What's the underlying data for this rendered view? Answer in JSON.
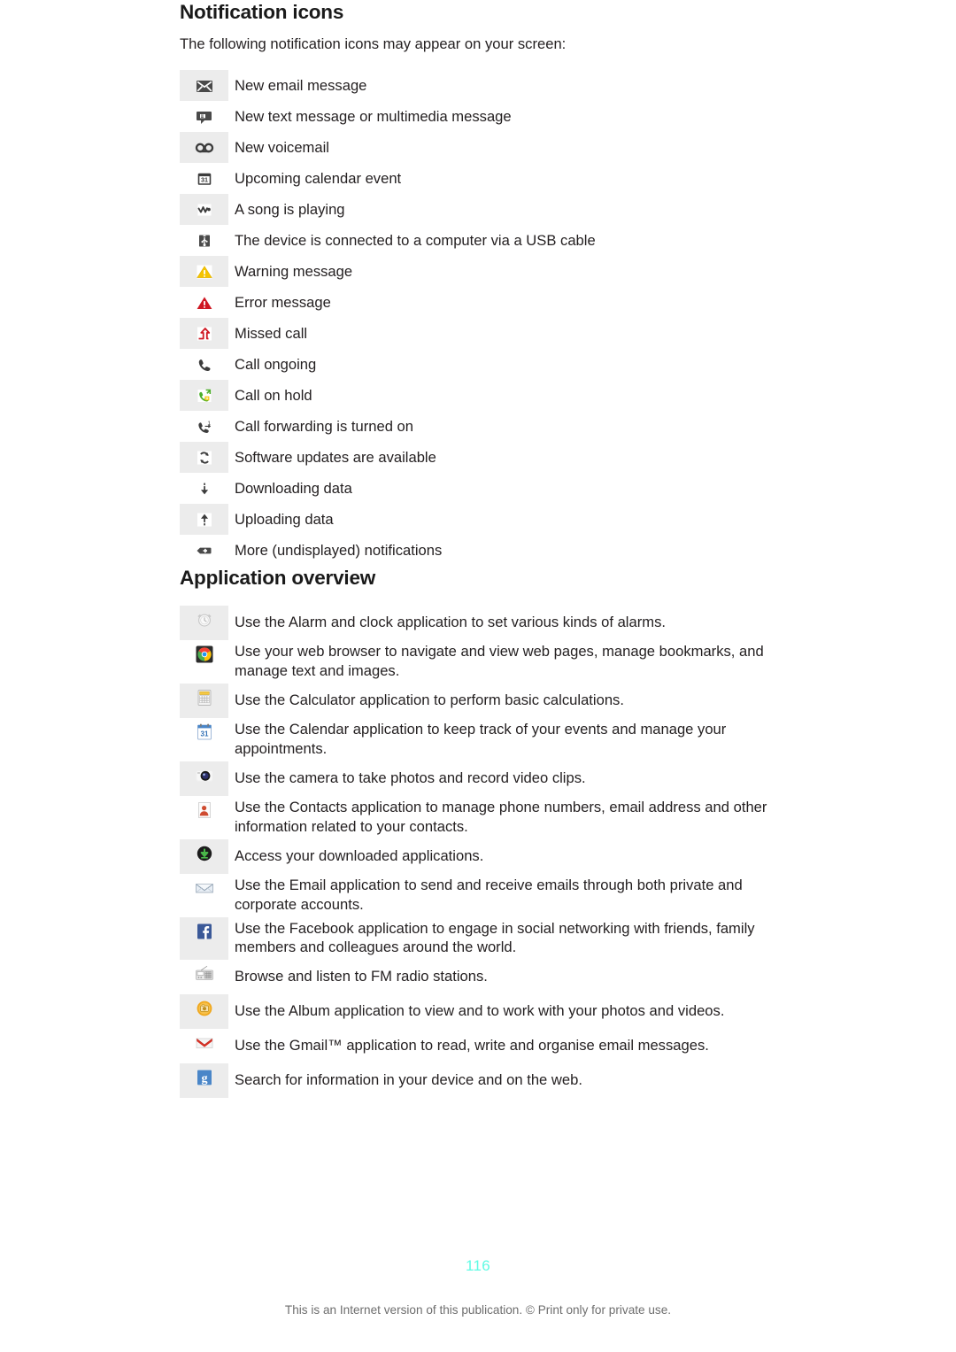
{
  "document": {
    "page_number": "116",
    "footer_note": "This is an Internet version of this publication. © Print only for private use."
  },
  "notification_section": {
    "heading": "Notification icons",
    "intro": "The following notification icons may appear on your screen:",
    "rows": [
      {
        "icon": "email-icon",
        "label": "New email message"
      },
      {
        "icon": "sms-message-icon",
        "label": "New text message or multimedia message"
      },
      {
        "icon": "voicemail-icon",
        "label": "New voicemail"
      },
      {
        "icon": "calendar-31-icon",
        "label": "Upcoming calendar event"
      },
      {
        "icon": "music-note-icon",
        "label": "A song is playing"
      },
      {
        "icon": "usb-icon",
        "label": "The device is connected to a computer via a USB cable"
      },
      {
        "icon": "warning-triangle-icon",
        "label": "Warning message"
      },
      {
        "icon": "error-triangle-icon",
        "label": "Error message"
      },
      {
        "icon": "missed-call-icon",
        "label": "Missed call"
      },
      {
        "icon": "call-ongoing-icon",
        "label": "Call ongoing"
      },
      {
        "icon": "call-on-hold-icon",
        "label": "Call on hold"
      },
      {
        "icon": "call-forwarding-icon",
        "label": "Call forwarding is turned on"
      },
      {
        "icon": "software-update-icon",
        "label": "Software updates are available"
      },
      {
        "icon": "download-arrow-icon",
        "label": "Downloading data"
      },
      {
        "icon": "upload-arrow-icon",
        "label": "Uploading data"
      },
      {
        "icon": "more-notifications-icon",
        "label": "More (undisplayed) notifications"
      }
    ]
  },
  "application_section": {
    "heading": "Application overview",
    "rows": [
      {
        "icon": "alarm-clock-icon",
        "label": "Use the Alarm and clock application to set various kinds of alarms."
      },
      {
        "icon": "web-browser-icon",
        "label": "Use your web browser to navigate and view web pages, manage bookmarks, and manage text and images."
      },
      {
        "icon": "calculator-icon",
        "label": "Use the Calculator application to perform basic calculations."
      },
      {
        "icon": "calendar-icon",
        "label": "Use the Calendar application to keep track of your events and manage your appointments."
      },
      {
        "icon": "camera-icon",
        "label": "Use the camera to take photos and record video clips."
      },
      {
        "icon": "contacts-icon",
        "label": "Use the Contacts application to manage phone numbers, email address and other information related to your contacts."
      },
      {
        "icon": "downloads-icon",
        "label": "Access your downloaded applications."
      },
      {
        "icon": "email-envelope-icon",
        "label": "Use the Email application to send and receive emails through both private and corporate accounts."
      },
      {
        "icon": "facebook-icon",
        "label": "Use the Facebook application to engage in social networking with friends, family members and colleagues around the world."
      },
      {
        "icon": "fm-radio-icon",
        "label": "Browse and listen to FM radio stations."
      },
      {
        "icon": "album-icon",
        "label": "Use the Album application to view and to work with your photos and videos."
      },
      {
        "icon": "gmail-icon",
        "label": "Use the Gmail™ application to read, write and organise email messages."
      },
      {
        "icon": "google-search-icon",
        "label": "Search for information in your device and on the web."
      }
    ]
  },
  "colors": {
    "row_shade": "#ececec",
    "page_number": "#5ffbe4",
    "text": "#231f20",
    "warning_yellow": "#f2c400",
    "error_red": "#cf1722"
  }
}
